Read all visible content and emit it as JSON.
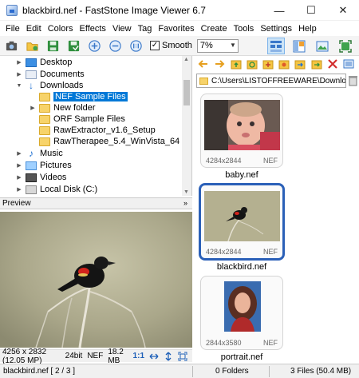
{
  "window": {
    "title": "blackbird.nef  -  FastStone Image Viewer 6.7",
    "minimize": "—",
    "maximize": "☐",
    "close": "✕"
  },
  "menu": [
    "File",
    "Edit",
    "Colors",
    "Effects",
    "View",
    "Tag",
    "Favorites",
    "Create",
    "Tools",
    "Settings",
    "Help"
  ],
  "toolbar": {
    "smooth_label": "Smooth",
    "smooth_checked": "✓",
    "zoom_value": "7%"
  },
  "tree": {
    "items": [
      {
        "label": "Desktop",
        "icon": "desktop-icon"
      },
      {
        "label": "Documents",
        "icon": "documents-icon"
      },
      {
        "label": "Downloads",
        "icon": "downloads-icon"
      },
      {
        "label": "NEF Sample Files",
        "icon": "folder-icon"
      },
      {
        "label": "New folder",
        "icon": "folder-icon"
      },
      {
        "label": "ORF Sample Files",
        "icon": "folder-icon"
      },
      {
        "label": "RawExtractor_v1.6_Setup",
        "icon": "folder-icon"
      },
      {
        "label": "RawTherapee_5.4_WinVista_64",
        "icon": "folder-icon"
      },
      {
        "label": "Music",
        "icon": "music-icon"
      },
      {
        "label": "Pictures",
        "icon": "pictures-icon"
      },
      {
        "label": "Videos",
        "icon": "videos-icon"
      },
      {
        "label": "Local Disk (C:)",
        "icon": "disk-icon"
      }
    ]
  },
  "preview": {
    "header": "Preview",
    "chevron": "»",
    "dimensions": "4256 x 2832 (12.05 MP)",
    "bit_depth": "24bit",
    "format": "NEF",
    "size": "18.2 MB",
    "ratio": "1:1"
  },
  "path": {
    "value": "C:\\Users\\LISTOFFREEWARE\\Downlo"
  },
  "thumbnails": [
    {
      "name": "baby.nef",
      "dims": "4284x2844",
      "type": "NEF",
      "selected": false
    },
    {
      "name": "blackbird.nef",
      "dims": "4284x2844",
      "type": "NEF",
      "selected": true
    },
    {
      "name": "portrait.nef",
      "dims": "2844x3580",
      "type": "NEF",
      "selected": false
    }
  ],
  "status": {
    "file": "blackbird.nef  [ 2 / 3 ]",
    "folders": "0 Folders",
    "files": "3 Files (50.4 MB)"
  },
  "colors": {
    "selection": "#0078d7",
    "thumb_selected_border": "#2b60b8"
  }
}
